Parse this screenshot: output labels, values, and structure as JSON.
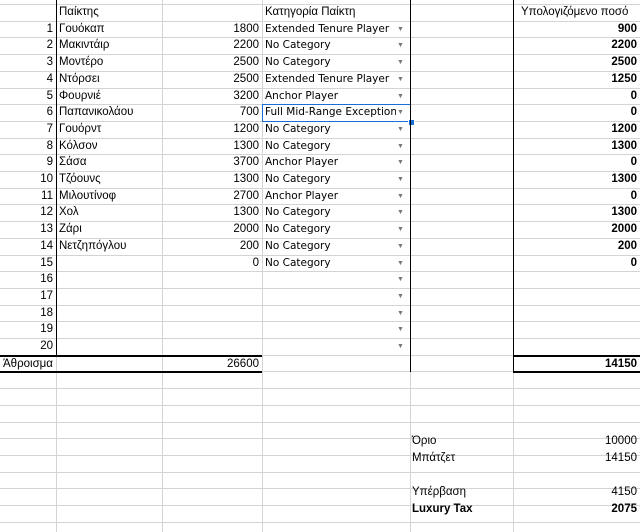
{
  "headers": {
    "player": "Παίκτης",
    "category": "Κατηγορία Παίκτη",
    "computed": "Υπολογιζόμενο ποσό"
  },
  "rows": [
    {
      "n": "1",
      "name": "Γουόκαπ",
      "salary": "1800",
      "category": "Extended Tenure Player",
      "computed": "900"
    },
    {
      "n": "2",
      "name": "Μακιντάιρ",
      "salary": "2200",
      "category": "No Category",
      "computed": "2200"
    },
    {
      "n": "3",
      "name": "Μοντέρο",
      "salary": "2500",
      "category": "No Category",
      "computed": "2500"
    },
    {
      "n": "4",
      "name": "Ντόρσει",
      "salary": "2500",
      "category": "Extended Tenure Player",
      "computed": "1250"
    },
    {
      "n": "5",
      "name": "Φουρνιέ",
      "salary": "3200",
      "category": "Anchor Player",
      "computed": "0"
    },
    {
      "n": "6",
      "name": "Παπανικολάου",
      "salary": "700",
      "category": "Full Mid-Range Exception",
      "computed": "0"
    },
    {
      "n": "7",
      "name": "Γουόρντ",
      "salary": "1200",
      "category": "No Category",
      "computed": "1200"
    },
    {
      "n": "8",
      "name": "Κόλσον",
      "salary": "1300",
      "category": "No Category",
      "computed": "1300"
    },
    {
      "n": "9",
      "name": "Σάσα",
      "salary": "3700",
      "category": "Anchor Player",
      "computed": "0"
    },
    {
      "n": "10",
      "name": "Τζόουνς",
      "salary": "1300",
      "category": "No Category",
      "computed": "1300"
    },
    {
      "n": "11",
      "name": "Μιλουτίνοφ",
      "salary": "2700",
      "category": "Anchor Player",
      "computed": "0"
    },
    {
      "n": "12",
      "name": "Χολ",
      "salary": "1300",
      "category": "No Category",
      "computed": "1300"
    },
    {
      "n": "13",
      "name": "Ζάρι",
      "salary": "2000",
      "category": "No Category",
      "computed": "2000"
    },
    {
      "n": "14",
      "name": "Νετζηπόγλου",
      "salary": "200",
      "category": "No Category",
      "computed": "200"
    },
    {
      "n": "15",
      "name": "",
      "salary": "0",
      "category": "No Category",
      "computed": "0"
    },
    {
      "n": "16",
      "name": "",
      "salary": "",
      "category": "",
      "computed": ""
    },
    {
      "n": "17",
      "name": "",
      "salary": "",
      "category": "",
      "computed": ""
    },
    {
      "n": "18",
      "name": "",
      "salary": "",
      "category": "",
      "computed": ""
    },
    {
      "n": "19",
      "name": "",
      "salary": "",
      "category": "",
      "computed": ""
    },
    {
      "n": "20",
      "name": "",
      "salary": "",
      "category": "",
      "computed": ""
    }
  ],
  "totals": {
    "label": "Άθροισμα",
    "salary": "26600",
    "computed": "14150"
  },
  "summary": [
    {
      "label": "Όριο",
      "value": "10000",
      "bold": false
    },
    {
      "label": "Μπάτζετ",
      "value": "14150",
      "bold": false
    },
    {
      "label": "Υπέρβαση",
      "value": "4150",
      "bold": false
    },
    {
      "label": "Luxury Tax",
      "value": "2075",
      "bold": true
    }
  ],
  "icons": {
    "dropdown": "dropdown-arrow-icon"
  },
  "colors": {
    "selection": "#1a6fd6",
    "grid": "#d4d4d4"
  }
}
